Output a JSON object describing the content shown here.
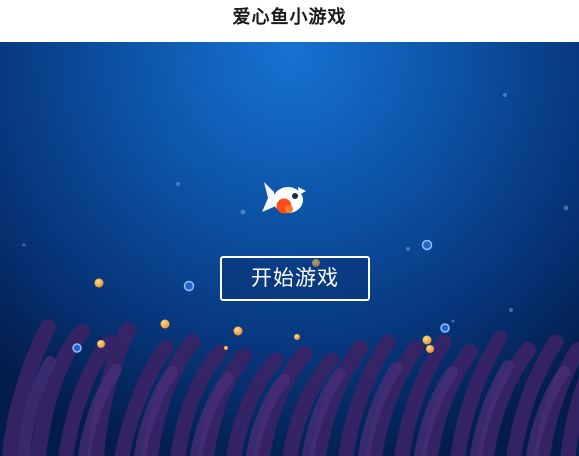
{
  "header": {
    "title": "爱心鱼小游戏"
  },
  "game": {
    "start_button_label": "开始游戏"
  },
  "colors": {
    "sea_center": "#1166c4",
    "sea_edge": "#031c4a",
    "seaweed": "#3a2466",
    "bubble_fruit": "#f2a43a",
    "bubble_blue": "#7ab4ff",
    "fish_body": "#ffffff",
    "fish_heart": "#ff4a1a"
  }
}
